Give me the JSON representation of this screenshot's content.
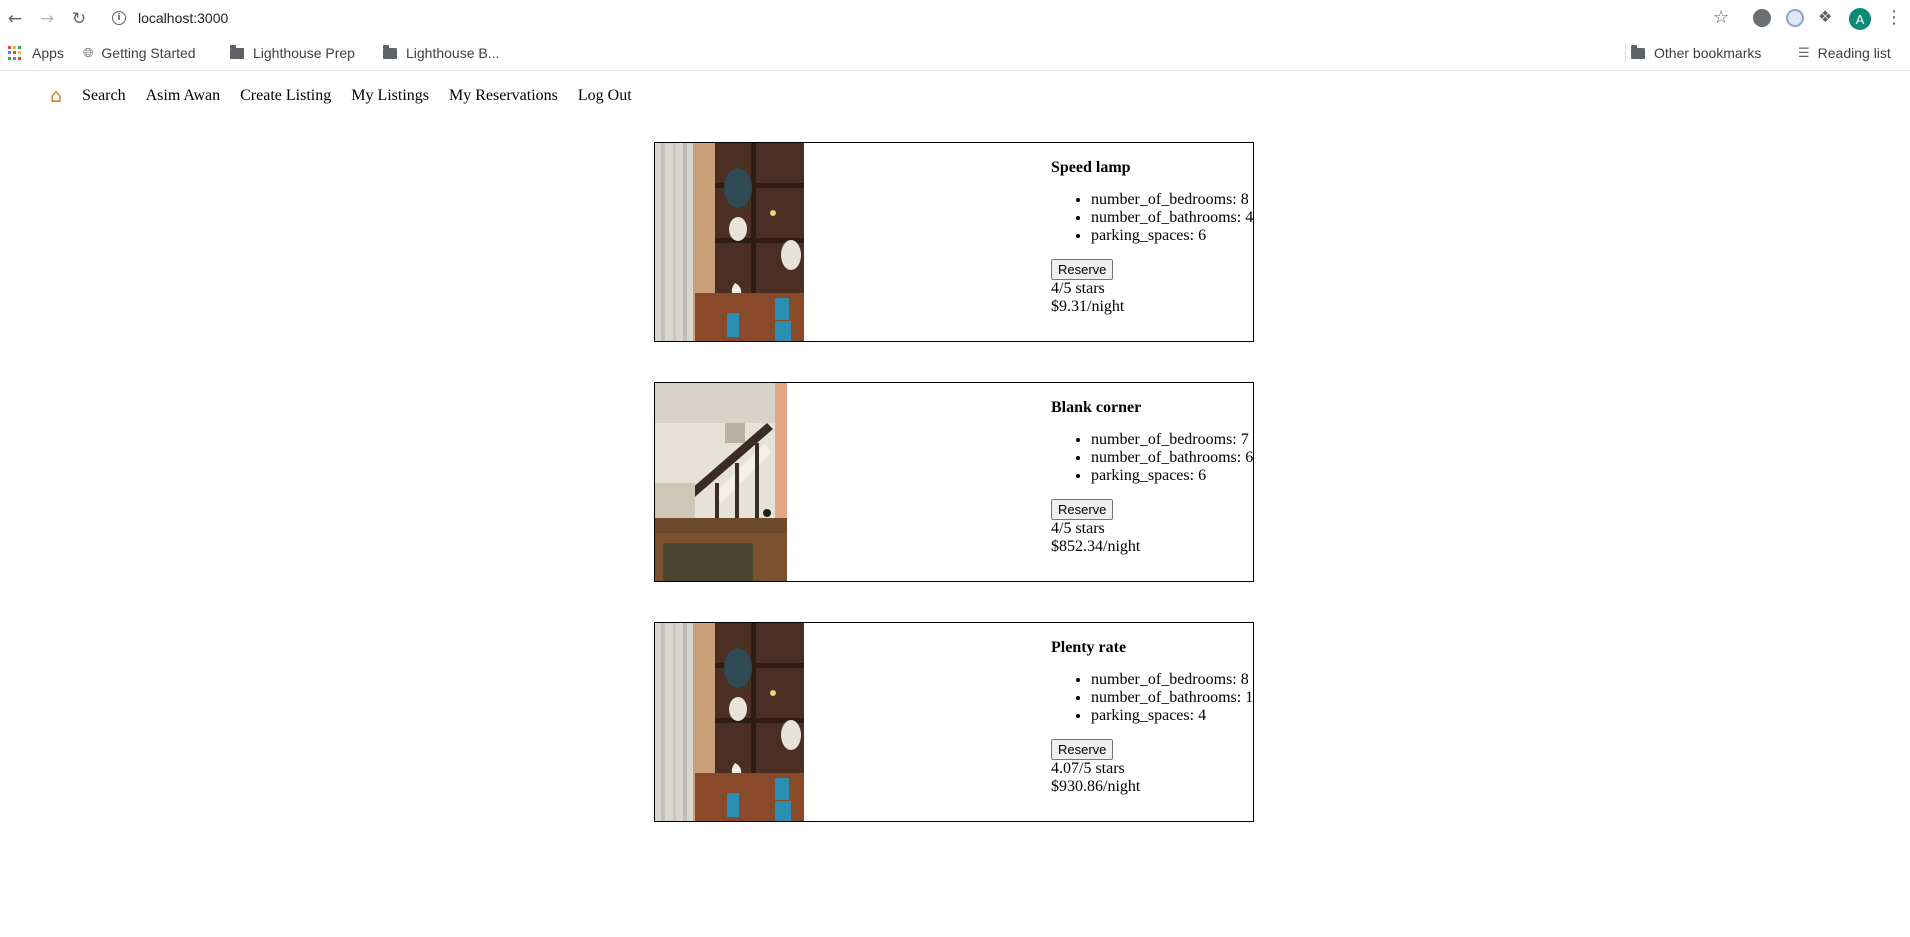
{
  "browser": {
    "url": "localhost:3000",
    "profile_initial": "A",
    "bookmarks": [
      {
        "label": "Apps",
        "icon": "apps-grid-icon"
      },
      {
        "label": "Getting Started",
        "icon": "globe-icon"
      },
      {
        "label": "Lighthouse Prep",
        "icon": "folder-icon"
      },
      {
        "label": "Lighthouse B...",
        "icon": "folder-icon"
      }
    ],
    "other_bookmarks": "Other bookmarks",
    "reading_list": "Reading list"
  },
  "nav": {
    "home_icon": "home-icon",
    "links": [
      "Search",
      "Asim Awan",
      "Create Listing",
      "My Listings",
      "My Reservations",
      "Log Out"
    ]
  },
  "listings": [
    {
      "title": "Speed lamp",
      "features": [
        "number_of_bedrooms: 8",
        "number_of_bathrooms: 4",
        "parking_spaces: 6"
      ],
      "reserve_label": "Reserve",
      "rating": "4/5 stars",
      "price": "$9.31/night",
      "image": "shelves-photo"
    },
    {
      "title": "Blank corner",
      "features": [
        "number_of_bedrooms: 7",
        "number_of_bathrooms: 6",
        "parking_spaces: 6"
      ],
      "reserve_label": "Reserve",
      "rating": "4/5 stars",
      "price": "$852.34/night",
      "image": "staircase-photo"
    },
    {
      "title": "Plenty rate",
      "features": [
        "number_of_bedrooms: 8",
        "number_of_bathrooms: 1",
        "parking_spaces: 4"
      ],
      "reserve_label": "Reserve",
      "rating": "4.07/5 stars",
      "price": "$930.86/night",
      "image": "shelves-photo"
    }
  ]
}
